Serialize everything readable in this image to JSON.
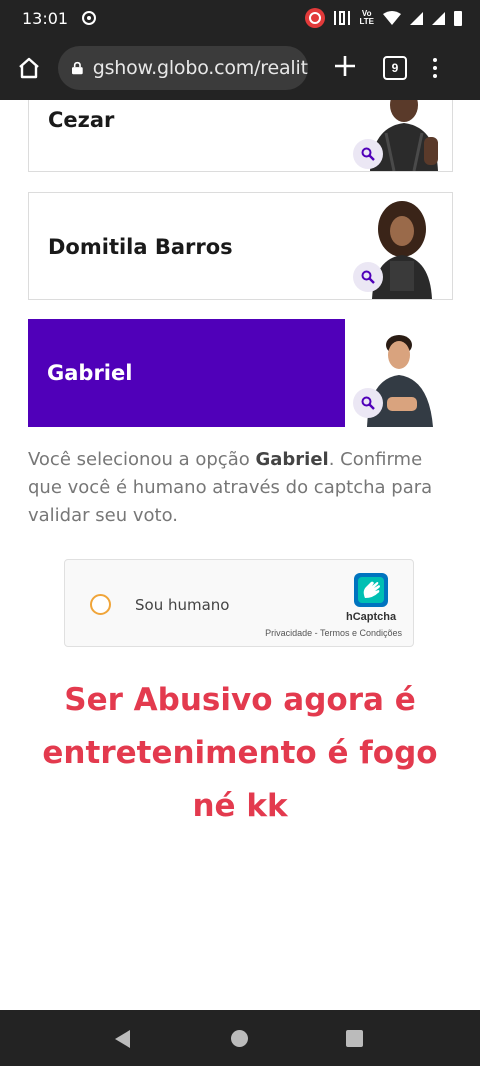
{
  "status_bar": {
    "time": "13:01",
    "volte_top": "Vo",
    "volte_bottom": "LTE"
  },
  "browser": {
    "url": "gshow.globo.com/realities",
    "tab_count": "9"
  },
  "candidates": [
    {
      "name": "Cezar",
      "selected": false
    },
    {
      "name": "Domitila Barros",
      "selected": false
    },
    {
      "name": "Gabriel",
      "selected": true
    }
  ],
  "confirmation": {
    "prefix": "Você selecionou a opção ",
    "option": "Gabriel",
    "suffix": ". Confirme que você é humano através do captcha para validar seu voto."
  },
  "captcha": {
    "checkbox_label": "Sou humano",
    "brand": "hCaptcha",
    "links": "Privacidade - Termos e Condições"
  },
  "caption": {
    "line1": "Ser Abusivo agora é",
    "line2": "entretenimento é fogo",
    "line3": "né kk"
  },
  "colors": {
    "selected_bg": "#5000b9",
    "caption": "#e33a4e",
    "captcha_checkbox": "#f0a53a",
    "hcaptcha_logo": "#0074bf"
  }
}
